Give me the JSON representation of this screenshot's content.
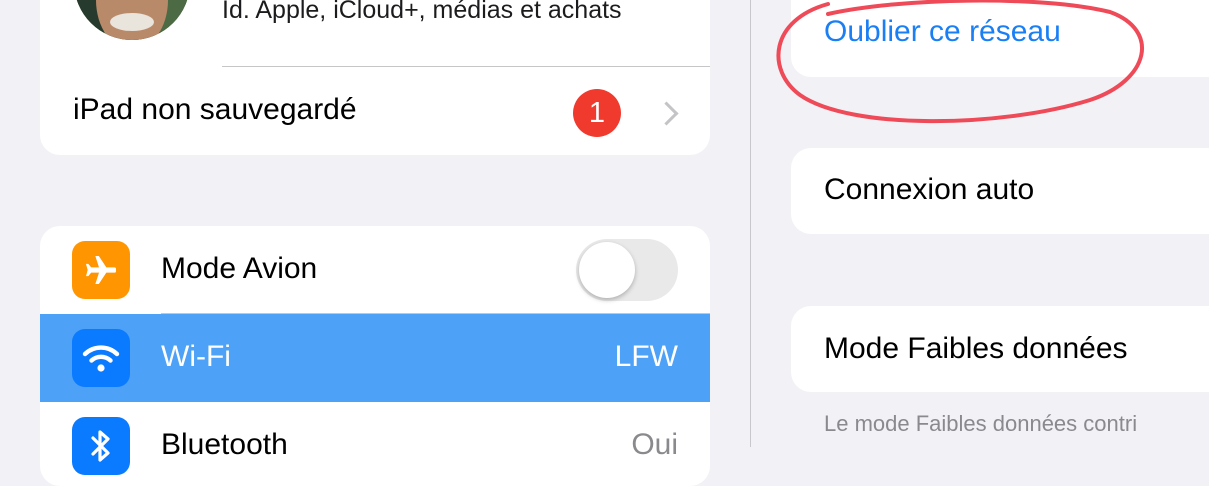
{
  "account": {
    "subtitle": "Id. Apple, iCloud+, médias et achats",
    "backup_label": "iPad non sauvegardé",
    "badge_count": "1"
  },
  "settings": {
    "airplane_label": "Mode Avion",
    "airplane_on": false,
    "wifi_label": "Wi-Fi",
    "wifi_value": "LFW",
    "bluetooth_label": "Bluetooth",
    "bluetooth_value": "Oui"
  },
  "network": {
    "forget_label": "Oublier ce réseau",
    "auto_join_label": "Connexion auto",
    "low_data_label": "Mode Faibles données",
    "low_data_note": "Le mode Faibles données contri"
  },
  "icons": {
    "airplane": "airplane-icon",
    "wifi": "wifi-icon",
    "bluetooth": "bluetooth-icon",
    "chevron": "chevron-right-icon"
  },
  "colors": {
    "accent_blue": "#1a7ff5",
    "selected_row": "#4da1f7",
    "airplane_orange": "#ff9500",
    "badge_red": "#f03a2e",
    "annotation_red": "#ee4a58"
  }
}
